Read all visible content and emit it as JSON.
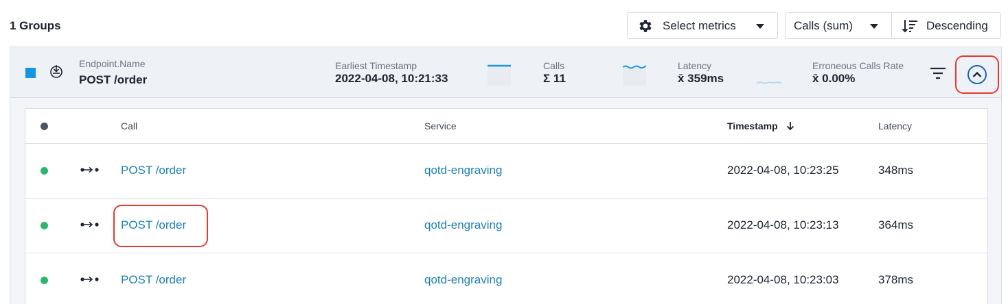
{
  "header": {
    "groups_title": "1 Groups",
    "select_metrics_label": "Select metrics",
    "sort_metric_label": "Calls (sum)",
    "sort_order_label": "Descending"
  },
  "group": {
    "color": "#1496e0",
    "endpoint_label": "Endpoint.Name",
    "endpoint_value": "POST /order",
    "earliest_label": "Earliest Timestamp",
    "earliest_value": "2022-04-08, 10:21:33",
    "calls_label": "Calls",
    "calls_value": "Σ 11",
    "latency_label": "Latency",
    "latency_value": "x̄ 359ms",
    "error_label": "Erroneous Calls Rate",
    "error_value": "x̄ 0.00%"
  },
  "table": {
    "columns": [
      "Call",
      "Service",
      "Timestamp",
      "Latency"
    ],
    "rows": [
      {
        "call": "POST /order",
        "service": "qotd-engraving",
        "timestamp": "2022-04-08, 10:23:25",
        "latency": "348ms",
        "status_color": "#2fb56b"
      },
      {
        "call": "POST /order",
        "service": "qotd-engraving",
        "timestamp": "2022-04-08, 10:23:13",
        "latency": "364ms",
        "status_color": "#2fb56b"
      },
      {
        "call": "POST /order",
        "service": "qotd-engraving",
        "timestamp": "2022-04-08, 10:23:03",
        "latency": "378ms",
        "status_color": "#2fb56b"
      }
    ]
  }
}
